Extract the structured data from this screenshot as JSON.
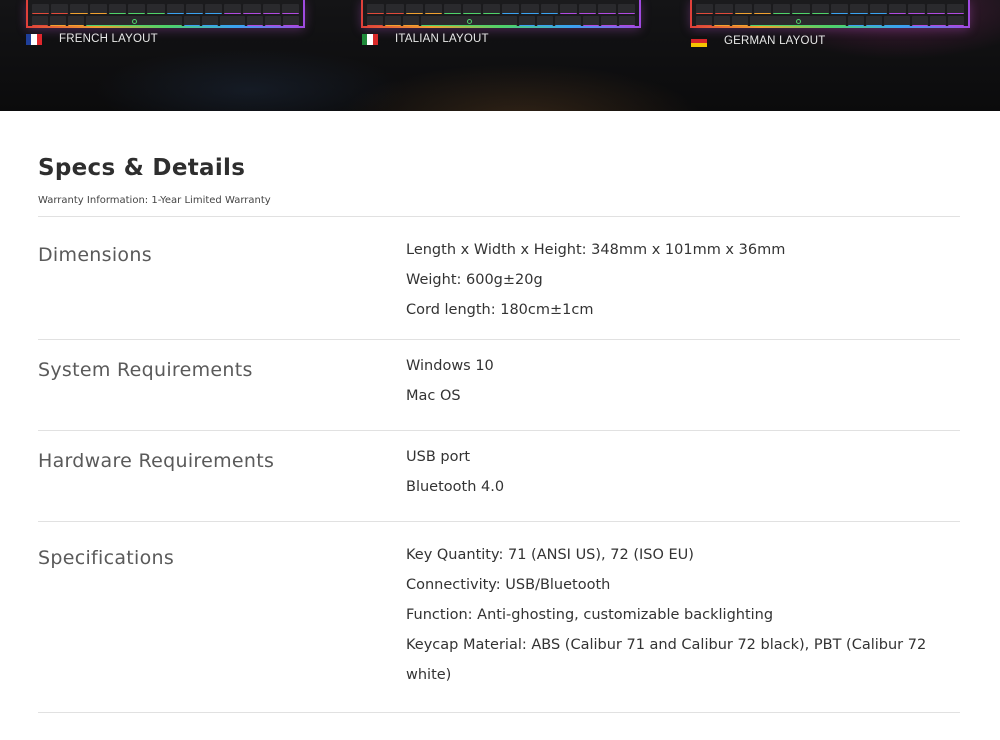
{
  "hero": {
    "layouts": [
      {
        "label": "FRENCH LAYOUT",
        "flag_colors": [
          "#1f3f9a",
          "#ffffff",
          "#e0262c"
        ]
      },
      {
        "label": "ITALIAN LAYOUT",
        "flag_colors": [
          "#1f8a3a",
          "#ffffff",
          "#d92a2a"
        ]
      },
      {
        "label": "GERMAN LAYOUT",
        "flag_colors": [
          "#111111",
          "#d8262a",
          "#f5c400"
        ]
      }
    ]
  },
  "specs": {
    "title": "Specs & Details",
    "warranty": "Warranty Information: 1-Year Limited Warranty",
    "rows": [
      {
        "label": "Dimensions",
        "values": [
          "Length x Width x Height: 348mm x 101mm x 36mm",
          "Weight: 600g±20g",
          "Cord length: 180cm±1cm"
        ]
      },
      {
        "label": "System Requirements",
        "values": [
          "Windows 10",
          "Mac OS"
        ]
      },
      {
        "label": "Hardware Requirements",
        "values": [
          "USB port",
          "Bluetooth 4.0"
        ]
      },
      {
        "label": "Specifications",
        "values": [
          "Key Quantity: 71 (ANSI US), 72 (ISO EU)",
          "Connectivity: USB/Bluetooth",
          "Function: Anti-ghosting, customizable backlighting",
          "Keycap Material: ABS (Calibur 71 and Calibur 72 black), PBT (Calibur 72 white)"
        ]
      }
    ]
  }
}
